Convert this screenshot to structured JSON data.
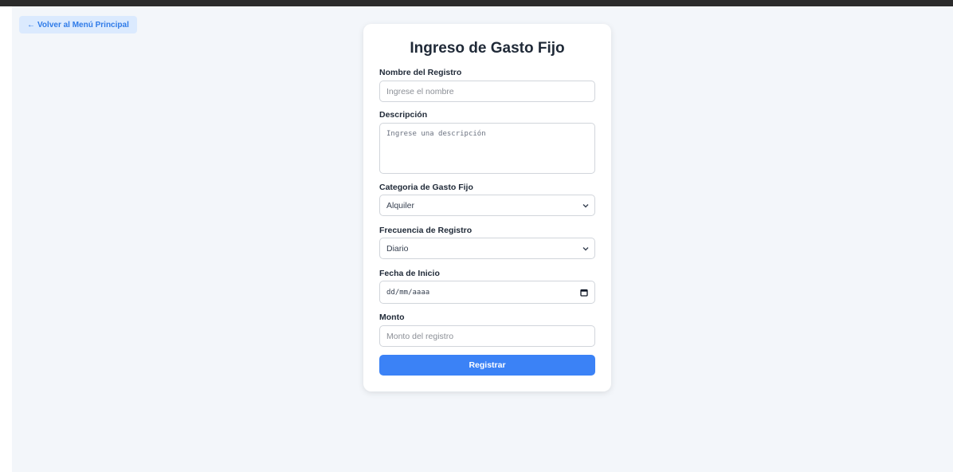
{
  "nav": {
    "back_arrow": "←",
    "back_label": "Volver al Menú Principal"
  },
  "form": {
    "title": "Ingreso de Gasto Fijo",
    "name_label": "Nombre del Registro",
    "name_placeholder": "Ingrese el nombre",
    "description_label": "Descripción",
    "description_placeholder": "Ingrese una descripción",
    "category_label": "Categoria de Gasto Fijo",
    "category_value": "Alquiler",
    "frequency_label": "Frecuencia de Registro",
    "frequency_value": "Diario",
    "start_date_label": "Fecha de Inicio",
    "start_date_placeholder": "dd/mm/aaaa",
    "amount_label": "Monto",
    "amount_placeholder": "Monto del registro",
    "submit_label": "Registrar"
  },
  "icons": {
    "back": "arrow-left-icon",
    "select": "chevron-down-icon",
    "date": "calendar-icon"
  },
  "colors": {
    "accent": "#3b82f6",
    "back_button_bg": "#dbeafe",
    "back_button_text": "#2f7be8",
    "page_bg": "#f3f6fa"
  }
}
